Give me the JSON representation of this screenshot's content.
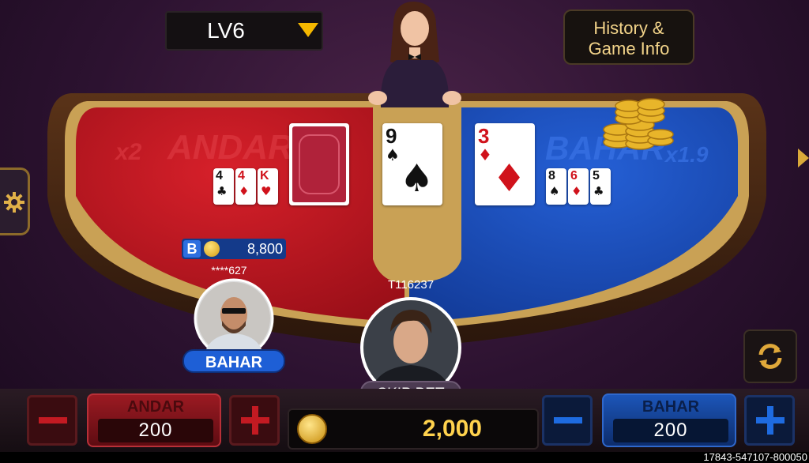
{
  "level": {
    "label": "LV6"
  },
  "history_button": {
    "line1": "History &",
    "line2": "Game Info"
  },
  "table": {
    "andar_label": "ANDAR",
    "andar_multiplier": "x2",
    "bahar_label": "BAHAR",
    "bahar_multiplier": "x1.9",
    "joker_card": {
      "rank": "9",
      "suit": "♠"
    },
    "andar_cards": [
      {
        "rank": "4",
        "suit": "♣"
      },
      {
        "rank": "4",
        "suit": "♦"
      },
      {
        "rank": "K",
        "suit": "♥"
      }
    ],
    "bahar_top_card": {
      "rank": "3",
      "suit": "♦"
    },
    "bahar_cards": [
      {
        "rank": "8",
        "suit": "♠"
      },
      {
        "rank": "6",
        "suit": "♦"
      },
      {
        "rank": "5",
        "suit": "♣"
      }
    ]
  },
  "player1": {
    "badge": "B",
    "balance": "8,800",
    "name": "****627",
    "bet_side": "BAHAR"
  },
  "player2": {
    "name": "T116237",
    "status": "SKIP BET"
  },
  "bottom": {
    "andar": {
      "label": "ANDAR",
      "value": "200"
    },
    "bahar": {
      "label": "BAHAR",
      "value": "200"
    },
    "chip_value": "2,000"
  },
  "footer": {
    "id": "17843-547107-800050"
  },
  "colors": {
    "andar": "#b3141c",
    "bahar": "#1d4fb8",
    "gold": "#c9a155"
  }
}
